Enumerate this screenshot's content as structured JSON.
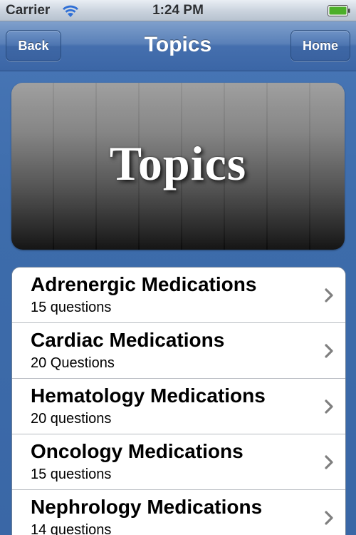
{
  "status_bar": {
    "carrier": "Carrier",
    "time": "1:24 PM",
    "wifi_icon": "wifi-icon",
    "battery_icon": "battery-icon",
    "battery_color": "#4caf2a"
  },
  "nav": {
    "back_label": "Back",
    "title": "Topics",
    "home_label": "Home"
  },
  "banner": {
    "text": "Topics"
  },
  "topics": [
    {
      "title": "Adrenergic Medications",
      "subtitle": "15 questions"
    },
    {
      "title": "Cardiac Medications",
      "subtitle": "20 Questions"
    },
    {
      "title": "Hematology Medications",
      "subtitle": "20 questions"
    },
    {
      "title": "Oncology Medications",
      "subtitle": "15 questions"
    },
    {
      "title": "Nephrology Medications",
      "subtitle": "14 questions"
    }
  ],
  "colors": {
    "nav_accent": "#3b66a6",
    "background": "#4a78b8"
  }
}
